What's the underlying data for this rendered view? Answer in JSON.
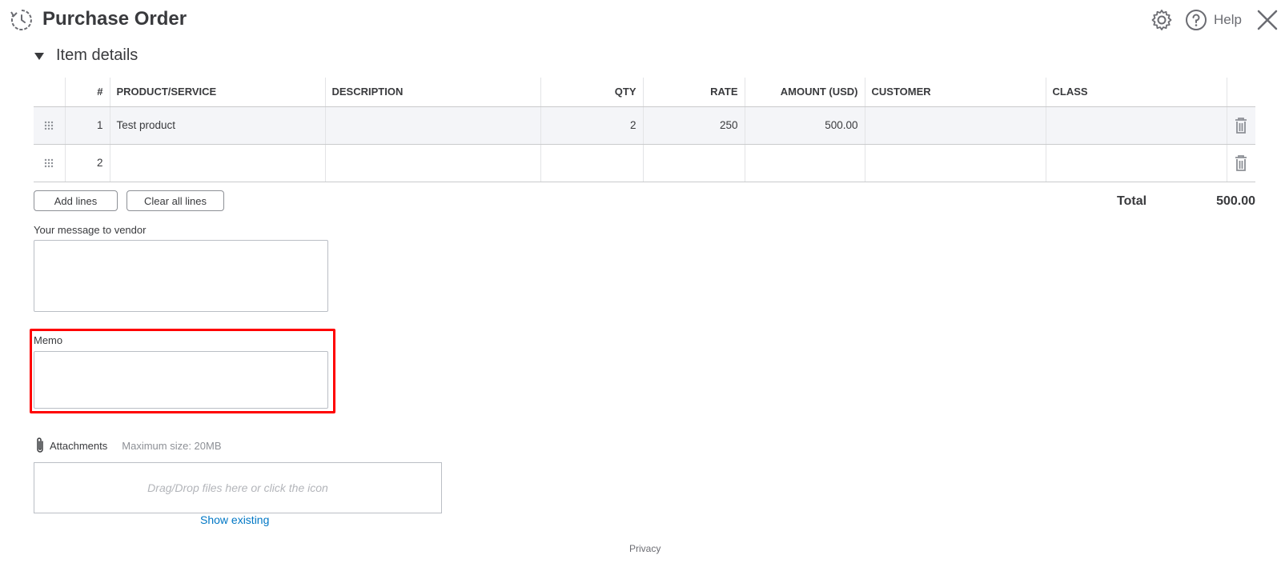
{
  "header": {
    "title": "Purchase Order",
    "help_label": "Help"
  },
  "section": {
    "title": "Item details"
  },
  "table": {
    "columns": [
      "#",
      "PRODUCT/SERVICE",
      "DESCRIPTION",
      "QTY",
      "RATE",
      "AMOUNT (USD)",
      "CUSTOMER",
      "CLASS"
    ],
    "rows": [
      {
        "num": "1",
        "product": "Test product",
        "description": "",
        "qty": "2",
        "rate": "250",
        "amount": "500.00",
        "customer": "",
        "class": ""
      },
      {
        "num": "2",
        "product": "",
        "description": "",
        "qty": "",
        "rate": "",
        "amount": "",
        "customer": "",
        "class": ""
      }
    ]
  },
  "actions": {
    "add_lines": "Add lines",
    "clear_lines": "Clear all lines"
  },
  "totals": {
    "label": "Total",
    "value": "500.00"
  },
  "vendor_message": {
    "label": "Your message to vendor",
    "value": ""
  },
  "memo": {
    "label": "Memo",
    "value": "",
    "highlight_color": "#ff0000"
  },
  "attachments": {
    "label": "Attachments",
    "max_size": "Maximum size: 20MB",
    "dropzone_text": "Drag/Drop files here or click the icon",
    "show_existing": "Show existing"
  },
  "footer": {
    "privacy": "Privacy"
  },
  "colors": {
    "link": "#0077c5",
    "text": "#393a3d",
    "row_highlight": "#f4f5f8"
  }
}
